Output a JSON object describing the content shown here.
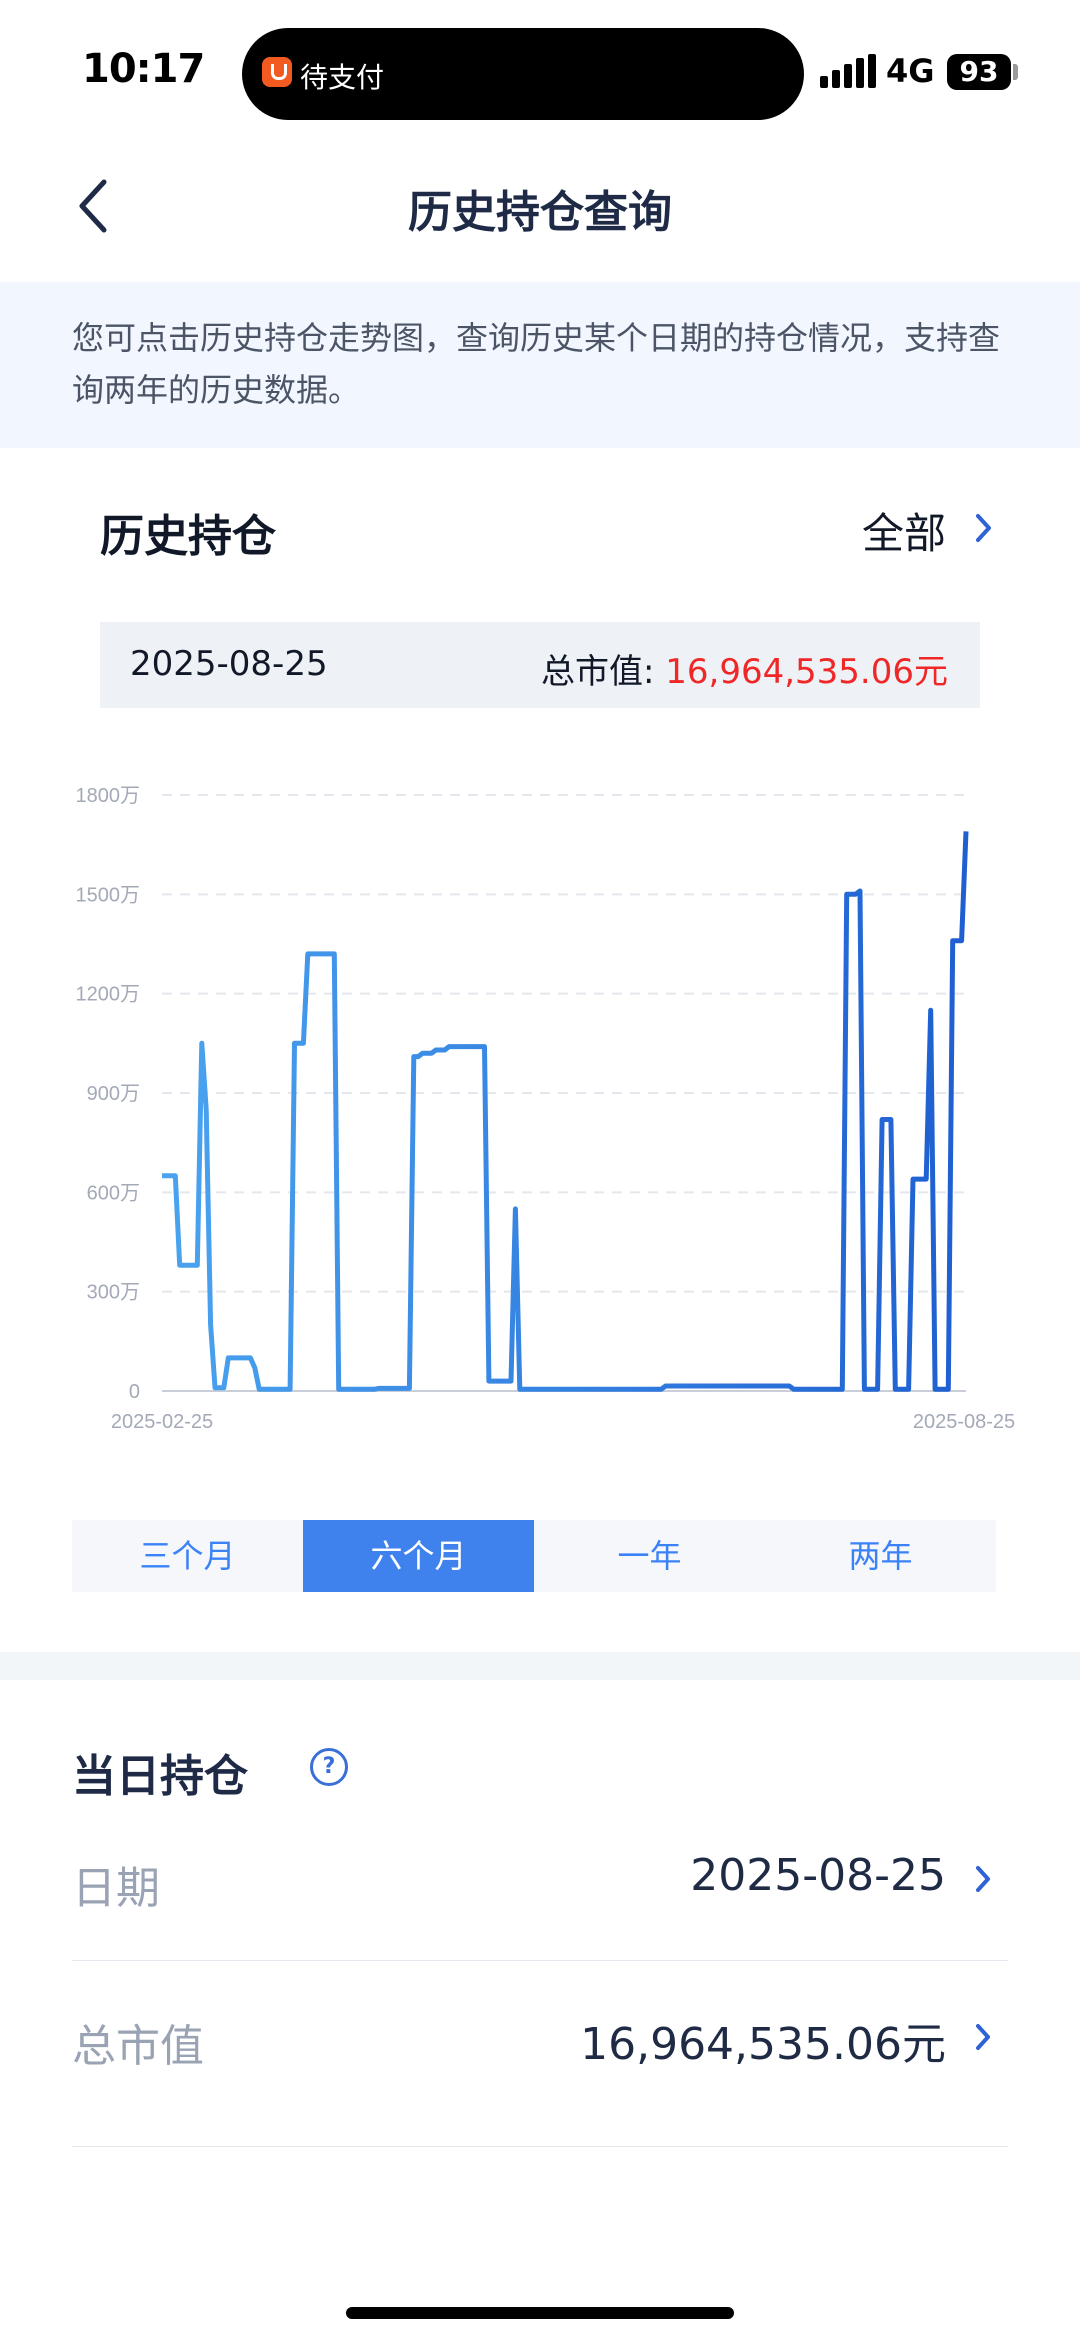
{
  "status_bar": {
    "time": "10:17",
    "app_pill_text": "待支付",
    "network": "4G",
    "battery": "93"
  },
  "header": {
    "title": "历史持仓查询"
  },
  "notice": {
    "text": "您可点击历史持仓走势图，查询历史某个日期的持仓情况，支持查询两年的历史数据。"
  },
  "holdings": {
    "title": "历史持仓",
    "filter_label": "全部",
    "selected_date": "2025-08-25",
    "total_label": "总市值: ",
    "total_value": "16,964,535.06元"
  },
  "colors": {
    "accent": "#3f82ed",
    "line_start": "#4aa3ef",
    "line_end": "#1f5fd1",
    "value_red": "#ef2727"
  },
  "chart_data": {
    "type": "line",
    "x_start_label": "2025-02-25",
    "x_end_label": "2025-08-25",
    "y_ticks": [
      "0",
      "300万",
      "600万",
      "900万",
      "1200万",
      "1500万",
      "1800万"
    ],
    "ylim": [
      0,
      1800
    ],
    "y_unit": "万",
    "grid": true,
    "series": [
      {
        "values": [
          650,
          650,
          650,
          650,
          380,
          380,
          380,
          380,
          380,
          1050,
          850,
          200,
          10,
          10,
          10,
          100,
          100,
          100,
          100,
          100,
          100,
          70,
          5,
          5,
          5,
          5,
          5,
          5,
          5,
          5,
          1050,
          1050,
          1050,
          1320,
          1320,
          1320,
          1320,
          1320,
          1320,
          1320,
          5,
          5,
          5,
          5,
          5,
          5,
          5,
          5,
          5,
          8,
          8,
          8,
          8,
          8,
          8,
          8,
          8,
          1010,
          1010,
          1020,
          1020,
          1020,
          1030,
          1030,
          1030,
          1040,
          1040,
          1040,
          1040,
          1040,
          1040,
          1040,
          1040,
          1040,
          30,
          30,
          30,
          30,
          30,
          30,
          550,
          5,
          5,
          5,
          5,
          5,
          5,
          5,
          5,
          5,
          5,
          5,
          5,
          5,
          5,
          5,
          5,
          5,
          5,
          5,
          5,
          5,
          5,
          5,
          5,
          5,
          5,
          5,
          5,
          5,
          5,
          5,
          5,
          5,
          15,
          15,
          15,
          15,
          15,
          15,
          15,
          15,
          15,
          15,
          15,
          15,
          15,
          15,
          15,
          15,
          15,
          15,
          15,
          15,
          15,
          15,
          15,
          15,
          15,
          15,
          15,
          15,
          15,
          5,
          5,
          5,
          5,
          5,
          5,
          5,
          5,
          5,
          5,
          5,
          5,
          1500,
          1500,
          1500,
          1510,
          5,
          5,
          5,
          5,
          820,
          820,
          820,
          5,
          5,
          5,
          5,
          640,
          640,
          640,
          640,
          1150,
          5,
          5,
          5,
          5,
          1360,
          1360,
          1360,
          1690
        ]
      }
    ]
  },
  "period_tabs": [
    {
      "label": "三个月",
      "active": false
    },
    {
      "label": "六个月",
      "active": true
    },
    {
      "label": "一年",
      "active": false
    },
    {
      "label": "两年",
      "active": false
    }
  ],
  "daily": {
    "title": "当日持仓",
    "help_glyph": "?",
    "rows": [
      {
        "label": "日期",
        "value": "2025-08-25"
      },
      {
        "label": "总市值",
        "value": "16,964,535.06元"
      }
    ]
  }
}
